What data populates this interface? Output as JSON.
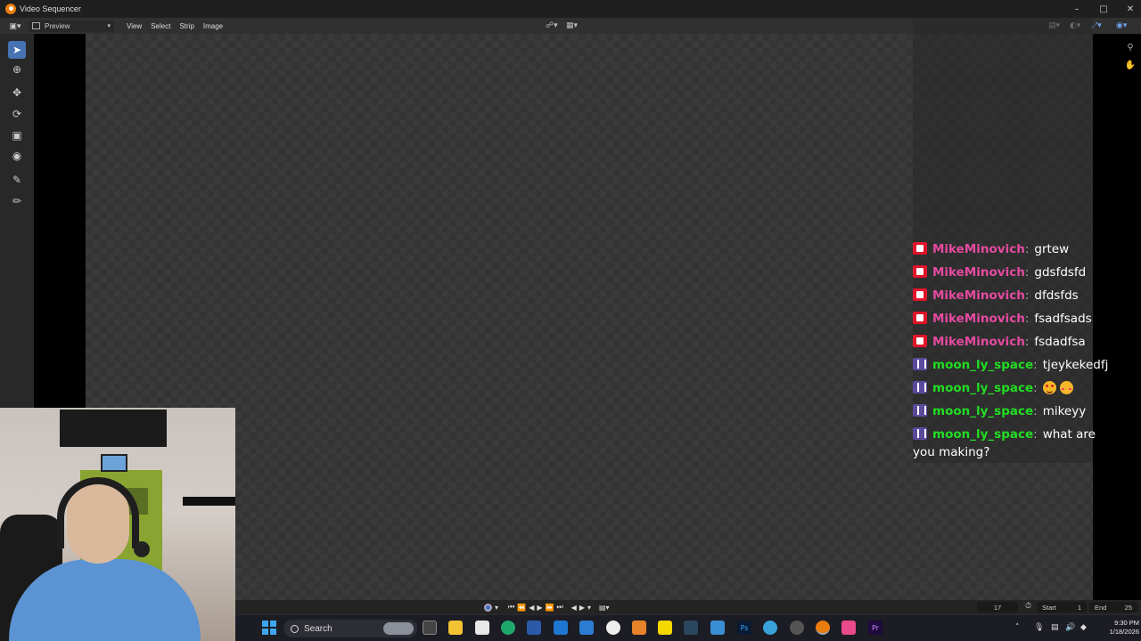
{
  "window": {
    "title": "Video Sequencer"
  },
  "header": {
    "view_mode": "Preview",
    "menus": [
      "View",
      "Select",
      "Strip",
      "Image"
    ]
  },
  "chat": {
    "messages": [
      {
        "platform": "youtube",
        "user": "MikeMinovich",
        "text": "grtew"
      },
      {
        "platform": "youtube",
        "user": "MikeMinovich",
        "text": "gdsfdsfd"
      },
      {
        "platform": "youtube",
        "user": "MikeMinovich",
        "text": "dfdsfds"
      },
      {
        "platform": "youtube",
        "user": "MikeMinovich",
        "text": "fsadfsads"
      },
      {
        "platform": "youtube",
        "user": "MikeMinovich",
        "text": "fsdadfsa"
      },
      {
        "platform": "twitch",
        "user": "moon_ly_space",
        "text": "tjeykekedfj"
      },
      {
        "platform": "twitch",
        "user": "moon_ly_space",
        "text": ""
      },
      {
        "platform": "twitch",
        "user": "moon_ly_space",
        "text": "mikeyy"
      },
      {
        "platform": "twitch",
        "user": "moon_ly_space",
        "text": "what are you making?"
      }
    ],
    "user_colors": {
      "MikeMinovich": "#e64aa0",
      "moon_ly_space": "#22dd22"
    }
  },
  "timeline": {
    "current_frame": "17",
    "start_label": "Start",
    "start_value": "1",
    "end_label": "End",
    "end_value": "25"
  },
  "taskbar": {
    "search_placeholder": "Search",
    "time": "9:30 PM",
    "date": "1/18/2026"
  },
  "colors": {
    "accent": "#4772b3",
    "blender_orange": "#e87d0d"
  }
}
